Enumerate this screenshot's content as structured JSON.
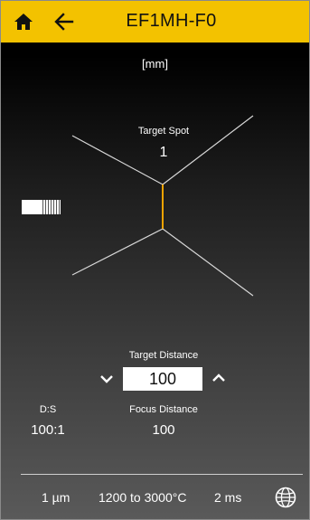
{
  "header": {
    "title": "EF1MH-F0",
    "home_icon": "home-icon",
    "back_icon": "arrow-left-icon",
    "background_color": "#f3c200"
  },
  "unit_label": "[mm]",
  "target_spot": {
    "label": "Target Spot",
    "value": "1",
    "spot_color": "#f3a300"
  },
  "target_distance": {
    "label": "Target Distance",
    "value": "100",
    "decrease_icon": "chevron-down-icon",
    "increase_icon": "chevron-up-icon"
  },
  "ds_ratio": {
    "label": "D:S",
    "value": "100:1"
  },
  "focus_distance": {
    "label": "Focus Distance",
    "value": "100"
  },
  "footer": {
    "resolution": "1 µm",
    "temperature_range": "1200 to 3000°C",
    "response_time": "2 ms",
    "settings_icon": "globe-icon"
  }
}
